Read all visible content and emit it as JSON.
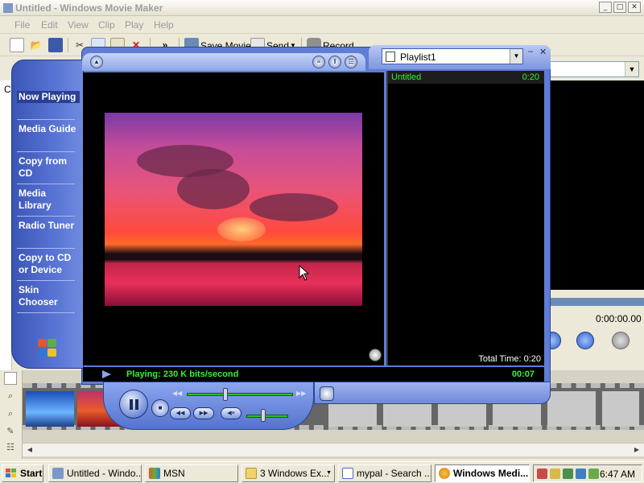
{
  "moviemaker": {
    "title": "Untitled - Windows Movie Maker",
    "window_controls": [
      "_",
      "□",
      "✕"
    ],
    "menu": [
      "File",
      "Edit",
      "View",
      "Clip",
      "Play",
      "Help"
    ],
    "toolbar": {
      "save_movie": "Save Movie",
      "send": "Send",
      "record": "Record",
      "more": "»"
    },
    "collections_label": "C",
    "preview_time": "0:00:00.00"
  },
  "player": {
    "nav": [
      "Now Playing",
      "Media Guide",
      "Copy from CD",
      "Media Library",
      "Radio Tuner",
      "Copy to CD or Device",
      "Skin Chooser"
    ],
    "nav_selected": "Now Playing",
    "playlist": {
      "name": "Playlist1",
      "items": [
        {
          "title": "Untitled",
          "duration": "0:20"
        }
      ],
      "total_time": "Total Time: 0:20"
    },
    "status_text": "Playing: 230 K bits/second",
    "elapsed": "00:07",
    "seek_position": 0.36,
    "volume_level": 0.4
  },
  "taskbar": {
    "start": "Start",
    "tasks": [
      {
        "label": "Untitled - Windo...",
        "active": false
      },
      {
        "label": "MSN",
        "active": false
      },
      {
        "label": "3 Windows Ex...",
        "active": false
      },
      {
        "label": "mypal - Search ...",
        "active": false
      },
      {
        "label": "Windows Medi...",
        "active": true
      }
    ],
    "clock": "6:47 AM"
  },
  "colors": {
    "player_blue": "#5f7cd6",
    "player_green_text": "#36f036",
    "sidebar_blue": "#3b55b5"
  },
  "icons": [
    "new-project-icon",
    "open-icon",
    "save-icon",
    "cut-icon",
    "copy-icon",
    "paste-icon",
    "delete-icon",
    "save-movie-icon",
    "send-icon",
    "record-icon",
    "play-icon",
    "pause-icon",
    "stop-icon",
    "previous-icon",
    "next-icon",
    "mute-icon",
    "windows-logo-icon"
  ]
}
